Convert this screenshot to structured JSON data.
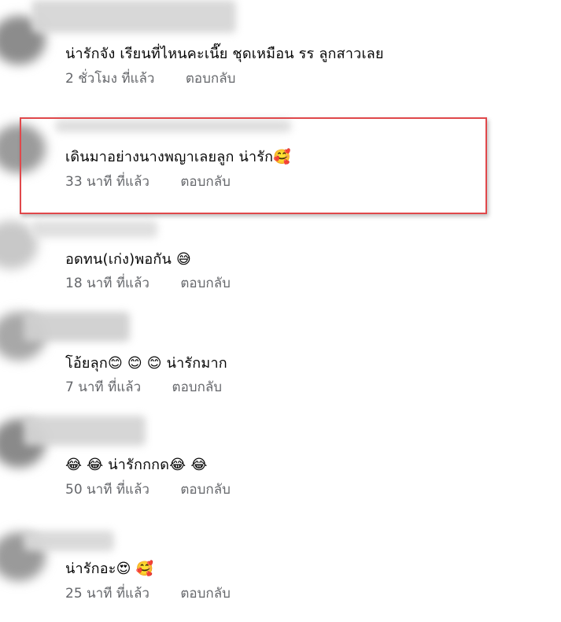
{
  "comments": [
    {
      "text": "น่ารักจัง เรียนที่ไหนคะเนี๊ย ชุดเหมือน รร ลูกสาวเลย",
      "time": "2 ชั่วโมง ที่แล้ว",
      "reply": "ตอบกลับ"
    },
    {
      "text": "เดินมาอย่างนางพญาเลยลูก น่ารัก🥰",
      "time": "33 นาที ที่แล้ว",
      "reply": "ตอบกลับ"
    },
    {
      "text": "อดทน(เก่ง)พอกัน 😅",
      "time": "18 นาที ที่แล้ว",
      "reply": "ตอบกลับ"
    },
    {
      "text": "โอ้ยลุก😊 😊 😊 น่ารักมาก",
      "time": "7 นาที ที่แล้ว",
      "reply": "ตอบกลับ"
    },
    {
      "text": "😂 😂 น่ารักกกด😂 😂",
      "time": "50 นาที ที่แล้ว",
      "reply": "ตอบกลับ"
    },
    {
      "text": "น่ารักอะ😍 🥰",
      "time": "25 นาที ที่แล้ว",
      "reply": "ตอบกลับ"
    }
  ],
  "colors": {
    "highlight_border": "#e0484b",
    "text": "#050505",
    "meta": "#65676b"
  }
}
